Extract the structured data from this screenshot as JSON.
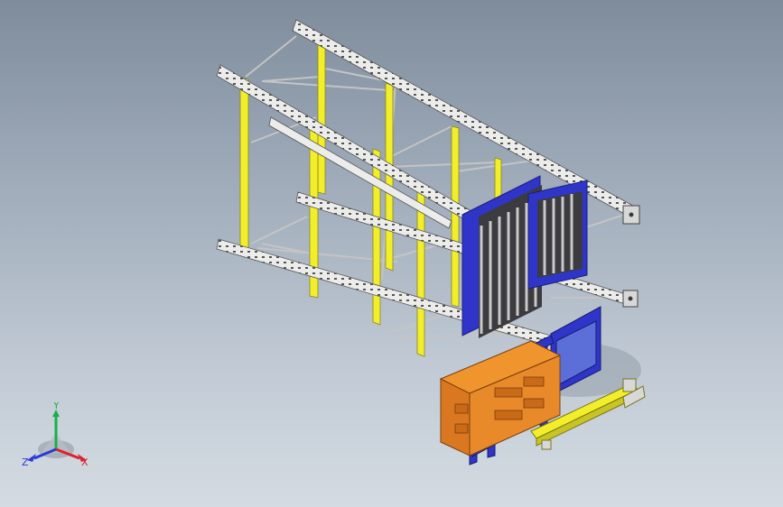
{
  "viewport": {
    "background_top": "#7e8c9c",
    "background_bottom": "#d4dbe2"
  },
  "model": {
    "frame_color": "#f2ee2a",
    "beam_color": "#e9e9e4",
    "pallet_color": "#2f35c9",
    "crate_color": "#e8892a",
    "brace_color": "#c8c8c8"
  },
  "triad": {
    "x_label": "X",
    "y_label": "Y",
    "z_label": "Z",
    "x_color": "#e0202a",
    "y_color": "#18b04a",
    "z_color": "#2a3ad8"
  }
}
